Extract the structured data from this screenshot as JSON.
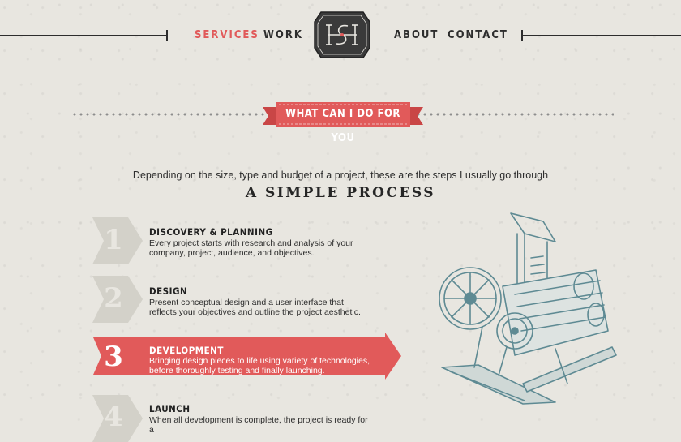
{
  "nav": {
    "items": [
      {
        "label": "SERVICES",
        "active": true
      },
      {
        "label": "WORK",
        "active": false
      },
      {
        "label": "ABOUT",
        "active": false
      },
      {
        "label": "CONTACT",
        "active": false
      }
    ],
    "logo_text": "ISI"
  },
  "section": {
    "banner": "WHAT CAN I DO FOR YOU",
    "intro": "Depending on the size, type and budget of a project, these are the steps I usually go through",
    "heading": "A SIMPLE PROCESS"
  },
  "steps": [
    {
      "number": "1",
      "title": "DISCOVERY & PLANNING",
      "desc": "Every project starts with research and analysis of your company, project, audience, and objectives."
    },
    {
      "number": "2",
      "title": "DESIGN",
      "desc": "Present conceptual design and a user interface that reflects your objectives and outline the project aesthetic."
    },
    {
      "number": "3",
      "title": "DEVELOPMENT",
      "desc": "Bringing design pieces to life using variety of technologies, before thoroughly testing and finally launching."
    },
    {
      "number": "4",
      "title": "LAUNCH",
      "desc": "When all development is complete, the project is ready for a"
    }
  ],
  "colors": {
    "accent": "#e15a5a",
    "background": "#e8e6e0",
    "text": "#2d2d2d",
    "step_arrow": "#d3d1c9",
    "illustration": "#5e8a93"
  },
  "icons": {
    "logo": "monogram-badge-icon",
    "illustration": "printing-press-illustration"
  }
}
